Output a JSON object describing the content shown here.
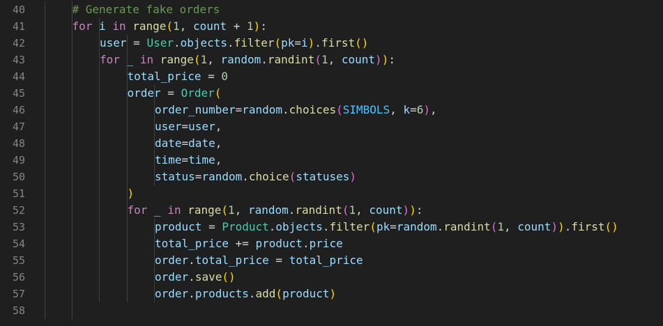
{
  "editor": {
    "language": "python",
    "theme_colors": {
      "background": "#1f1f1f",
      "line_number": "#858585",
      "keyword": "#c586c0",
      "function": "#dcdcaa",
      "class": "#4ec9b0",
      "variable": "#9cdcfe",
      "number": "#b5cea8",
      "constant": "#4fc1ff",
      "comment": "#6a9955",
      "bracket_level_1": "#ffd700",
      "bracket_level_2": "#da70d6",
      "bracket_level_3": "#179fff"
    },
    "lines": [
      {
        "number": "40",
        "indent": 2,
        "tokens": [
          [
            "com",
            "# Generate fake orders"
          ]
        ]
      },
      {
        "number": "41",
        "indent": 2,
        "tokens": [
          [
            "kw",
            "for"
          ],
          [
            "pl",
            " "
          ],
          [
            "var",
            "i"
          ],
          [
            "pl",
            " "
          ],
          [
            "kw",
            "in"
          ],
          [
            "pl",
            " "
          ],
          [
            "fn",
            "range"
          ],
          [
            "br1",
            "("
          ],
          [
            "num",
            "1"
          ],
          [
            "pl",
            ", "
          ],
          [
            "var",
            "count"
          ],
          [
            "pl",
            " + "
          ],
          [
            "num",
            "1"
          ],
          [
            "br1",
            ")"
          ],
          [
            "pl",
            ":"
          ]
        ]
      },
      {
        "number": "42",
        "indent": 3,
        "tokens": [
          [
            "var",
            "user"
          ],
          [
            "pl",
            " = "
          ],
          [
            "cls",
            "User"
          ],
          [
            "pl",
            "."
          ],
          [
            "var",
            "objects"
          ],
          [
            "pl",
            "."
          ],
          [
            "fn",
            "filter"
          ],
          [
            "br1",
            "("
          ],
          [
            "var",
            "pk"
          ],
          [
            "pl",
            "="
          ],
          [
            "var",
            "i"
          ],
          [
            "br1",
            ")"
          ],
          [
            "pl",
            "."
          ],
          [
            "fn",
            "first"
          ],
          [
            "br1",
            "()"
          ]
        ]
      },
      {
        "number": "43",
        "indent": 3,
        "tokens": [
          [
            "kw",
            "for"
          ],
          [
            "pl",
            " "
          ],
          [
            "var",
            "_"
          ],
          [
            "pl",
            " "
          ],
          [
            "kw",
            "in"
          ],
          [
            "pl",
            " "
          ],
          [
            "fn",
            "range"
          ],
          [
            "br1",
            "("
          ],
          [
            "num",
            "1"
          ],
          [
            "pl",
            ", "
          ],
          [
            "var",
            "random"
          ],
          [
            "pl",
            "."
          ],
          [
            "fn",
            "randint"
          ],
          [
            "br2",
            "("
          ],
          [
            "num",
            "1"
          ],
          [
            "pl",
            ", "
          ],
          [
            "var",
            "count"
          ],
          [
            "br2",
            ")"
          ],
          [
            "br1",
            ")"
          ],
          [
            "pl",
            ":"
          ]
        ]
      },
      {
        "number": "44",
        "indent": 4,
        "tokens": [
          [
            "var",
            "total_price"
          ],
          [
            "pl",
            " = "
          ],
          [
            "num",
            "0"
          ]
        ]
      },
      {
        "number": "45",
        "indent": 4,
        "tokens": [
          [
            "var",
            "order"
          ],
          [
            "pl",
            " = "
          ],
          [
            "cls",
            "Order"
          ],
          [
            "br1",
            "("
          ]
        ]
      },
      {
        "number": "46",
        "indent": 5,
        "tokens": [
          [
            "var",
            "order_number"
          ],
          [
            "pl",
            "="
          ],
          [
            "var",
            "random"
          ],
          [
            "pl",
            "."
          ],
          [
            "fn",
            "choices"
          ],
          [
            "br2",
            "("
          ],
          [
            "const",
            "SIMBOLS"
          ],
          [
            "pl",
            ", "
          ],
          [
            "var",
            "k"
          ],
          [
            "pl",
            "="
          ],
          [
            "num",
            "6"
          ],
          [
            "br2",
            ")"
          ],
          [
            "pl",
            ","
          ]
        ]
      },
      {
        "number": "47",
        "indent": 5,
        "tokens": [
          [
            "var",
            "user"
          ],
          [
            "pl",
            "="
          ],
          [
            "var",
            "user"
          ],
          [
            "pl",
            ","
          ]
        ]
      },
      {
        "number": "48",
        "indent": 5,
        "tokens": [
          [
            "var",
            "date"
          ],
          [
            "pl",
            "="
          ],
          [
            "var",
            "date"
          ],
          [
            "pl",
            ","
          ]
        ]
      },
      {
        "number": "49",
        "indent": 5,
        "tokens": [
          [
            "var",
            "time"
          ],
          [
            "pl",
            "="
          ],
          [
            "var",
            "time"
          ],
          [
            "pl",
            ","
          ]
        ]
      },
      {
        "number": "50",
        "indent": 5,
        "tokens": [
          [
            "var",
            "status"
          ],
          [
            "pl",
            "="
          ],
          [
            "var",
            "random"
          ],
          [
            "pl",
            "."
          ],
          [
            "fn",
            "choice"
          ],
          [
            "br2",
            "("
          ],
          [
            "var",
            "statuses"
          ],
          [
            "br2",
            ")"
          ]
        ]
      },
      {
        "number": "51",
        "indent": 4,
        "tokens": [
          [
            "br1",
            ")"
          ]
        ]
      },
      {
        "number": "52",
        "indent": 4,
        "tokens": [
          [
            "kw",
            "for"
          ],
          [
            "pl",
            " "
          ],
          [
            "var",
            "_"
          ],
          [
            "pl",
            " "
          ],
          [
            "kw",
            "in"
          ],
          [
            "pl",
            " "
          ],
          [
            "fn",
            "range"
          ],
          [
            "br1",
            "("
          ],
          [
            "num",
            "1"
          ],
          [
            "pl",
            ", "
          ],
          [
            "var",
            "random"
          ],
          [
            "pl",
            "."
          ],
          [
            "fn",
            "randint"
          ],
          [
            "br2",
            "("
          ],
          [
            "num",
            "1"
          ],
          [
            "pl",
            ", "
          ],
          [
            "var",
            "count"
          ],
          [
            "br2",
            ")"
          ],
          [
            "br1",
            ")"
          ],
          [
            "pl",
            ":"
          ]
        ]
      },
      {
        "number": "53",
        "indent": 5,
        "tokens": [
          [
            "var",
            "product"
          ],
          [
            "pl",
            " = "
          ],
          [
            "cls",
            "Product"
          ],
          [
            "pl",
            "."
          ],
          [
            "var",
            "objects"
          ],
          [
            "pl",
            "."
          ],
          [
            "fn",
            "filter"
          ],
          [
            "br1",
            "("
          ],
          [
            "var",
            "pk"
          ],
          [
            "pl",
            "="
          ],
          [
            "var",
            "random"
          ],
          [
            "pl",
            "."
          ],
          [
            "fn",
            "randint"
          ],
          [
            "br2",
            "("
          ],
          [
            "num",
            "1"
          ],
          [
            "pl",
            ", "
          ],
          [
            "var",
            "count"
          ],
          [
            "br2",
            ")"
          ],
          [
            "br1",
            ")"
          ],
          [
            "pl",
            "."
          ],
          [
            "fn",
            "first"
          ],
          [
            "br1",
            "()"
          ]
        ]
      },
      {
        "number": "54",
        "indent": 5,
        "tokens": [
          [
            "var",
            "total_price"
          ],
          [
            "pl",
            " += "
          ],
          [
            "var",
            "product"
          ],
          [
            "pl",
            "."
          ],
          [
            "var",
            "price"
          ]
        ]
      },
      {
        "number": "55",
        "indent": 5,
        "tokens": [
          [
            "var",
            "order"
          ],
          [
            "pl",
            "."
          ],
          [
            "var",
            "total_price"
          ],
          [
            "pl",
            " = "
          ],
          [
            "var",
            "total_price"
          ]
        ]
      },
      {
        "number": "56",
        "indent": 5,
        "tokens": [
          [
            "var",
            "order"
          ],
          [
            "pl",
            "."
          ],
          [
            "fn",
            "save"
          ],
          [
            "br1",
            "()"
          ]
        ]
      },
      {
        "number": "57",
        "indent": 5,
        "tokens": [
          [
            "var",
            "order"
          ],
          [
            "pl",
            "."
          ],
          [
            "var",
            "products"
          ],
          [
            "pl",
            "."
          ],
          [
            "fn",
            "add"
          ],
          [
            "br1",
            "("
          ],
          [
            "var",
            "product"
          ],
          [
            "br1",
            ")"
          ]
        ]
      },
      {
        "number": "58",
        "indent": 0,
        "tokens": []
      }
    ]
  }
}
